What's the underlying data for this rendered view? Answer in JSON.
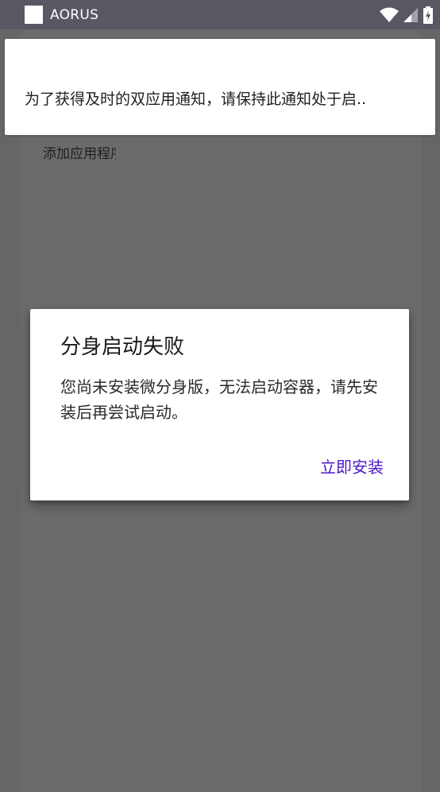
{
  "status_bar": {
    "app_name": "AORUS",
    "icons": [
      "app-square-icon",
      "wifi-icon",
      "signal-icon",
      "battery-icon"
    ]
  },
  "background": {
    "partial_label": "添加应用程序"
  },
  "notification": {
    "text": "为了获得及时的双应用通知，请保持此通知处于启.."
  },
  "dialog": {
    "title": "分身启动失败",
    "message": "您尚未安装微分身版，无法启动容器，请先安装后再尝试启动。",
    "install_button_label": "立即安装"
  },
  "colors": {
    "accent": "#4a18c9",
    "status_bar": "#5a5763",
    "scrim": "#666666"
  }
}
